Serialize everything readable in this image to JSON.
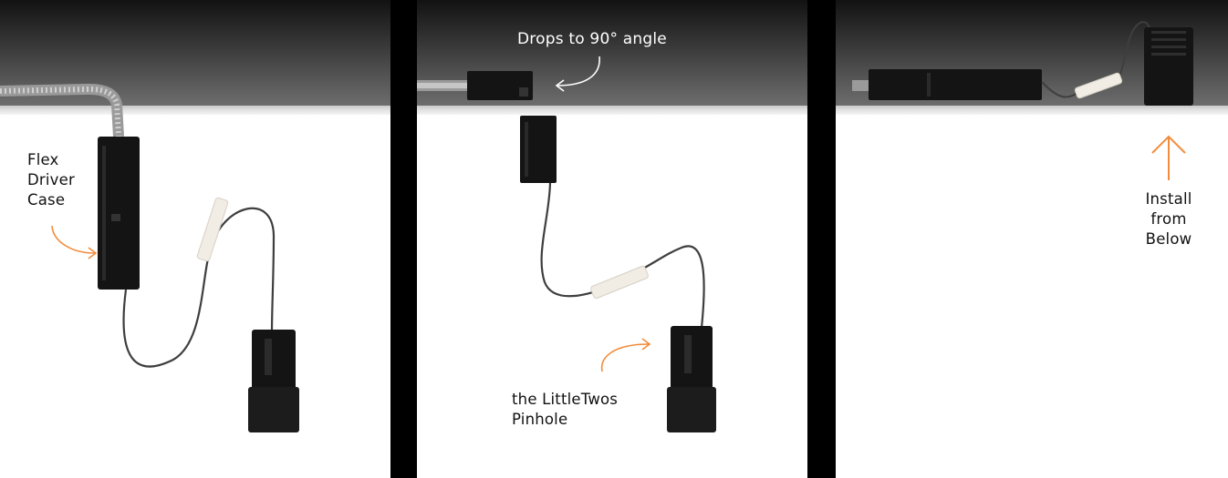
{
  "panels": [
    {
      "name": "panel-flex-driver-case",
      "label_lines": [
        "Flex",
        "Driver",
        "Case"
      ]
    },
    {
      "name": "panel-drops-angle",
      "top_label": "Drops to 90° angle",
      "bottom_label_lines": [
        "the LittleTwos",
        "Pinhole"
      ]
    },
    {
      "name": "panel-install-from-below",
      "label_lines": [
        "Install",
        "from",
        "Below"
      ]
    }
  ],
  "colors": {
    "accent_orange": "#f28c3c",
    "ceiling_dark": "#1a1a1a",
    "device_black": "#141414",
    "background": "#ffffff",
    "gap": "#000000"
  },
  "icons": [
    "curved-arrow-icon",
    "up-arrow-icon"
  ]
}
